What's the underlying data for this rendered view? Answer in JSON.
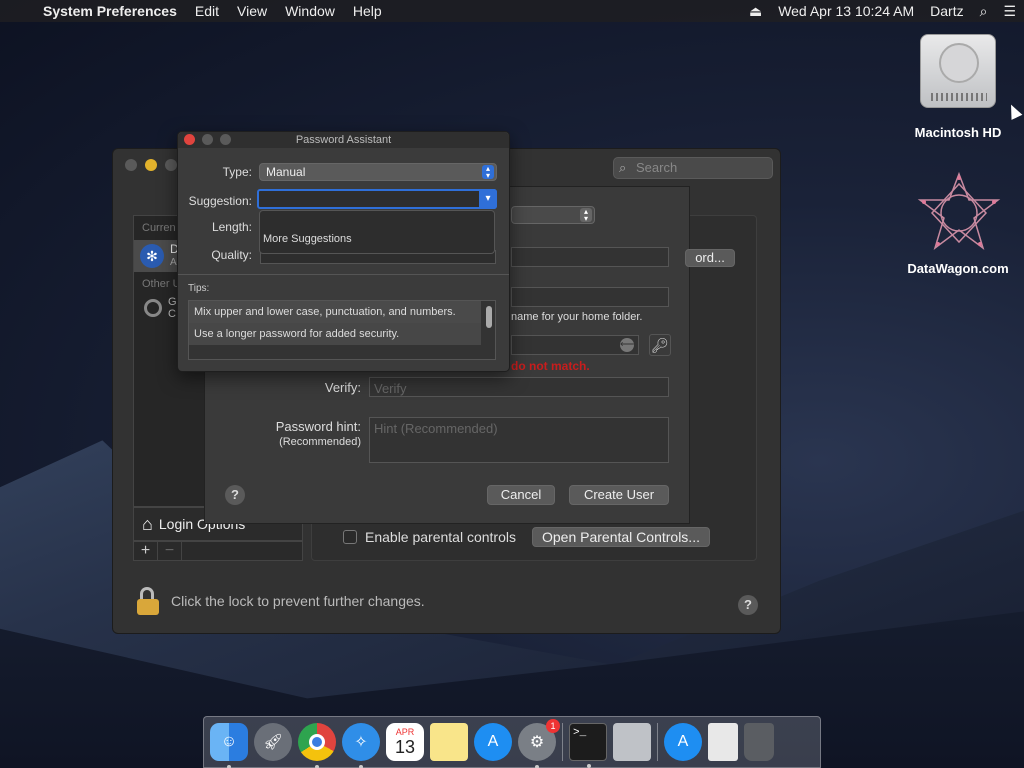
{
  "menubar": {
    "app_name": "System Preferences",
    "menus": [
      "Edit",
      "View",
      "Window",
      "Help"
    ],
    "clock": "Wed Apr 13  10:24 AM",
    "user": "Dartz"
  },
  "desktop": {
    "hd_label": "Macintosh HD",
    "datawagon_label": "DataWagon.com"
  },
  "prefs": {
    "search_placeholder": "Search",
    "user_list": {
      "current_header": "Curren",
      "other_header": "Other U",
      "selected_initial": "D",
      "selected_sub": "A",
      "other_initial": "G",
      "other_sub": "C"
    },
    "login_options": "Login Options",
    "plus": "+",
    "minus": "−",
    "enable_parental": "Enable parental controls",
    "open_parental": "Open Parental Controls...",
    "lock_text": "Click the lock to prevent further changes.",
    "help": "?"
  },
  "new_user_sheet": {
    "password_btn": "ord...",
    "home_folder_hint": "name for your home folder.",
    "mismatch_error": "do not match.",
    "verify_label": "Verify:",
    "verify_placeholder": "Verify",
    "hint_label": "Password hint:",
    "hint_sub": "(Recommended)",
    "hint_placeholder": "Hint (Recommended)",
    "cancel": "Cancel",
    "create": "Create User",
    "help": "?"
  },
  "password_assistant": {
    "title": "Password Assistant",
    "type_label": "Type:",
    "type_value": "Manual",
    "suggestion_label": "Suggestion:",
    "suggestion_value": "",
    "length_label": "Length:",
    "quality_label": "Quality:",
    "dropdown_item": "More Suggestions",
    "tips_label": "Tips:",
    "tips": [
      "Mix upper and lower case, punctuation, and numbers.",
      "Use a longer password for added security."
    ]
  },
  "dock": {
    "calendar_month": "APR",
    "calendar_day": "13",
    "prefs_badge": "1",
    "items": [
      "finder-icon",
      "launchpad-icon",
      "chrome-icon",
      "safari-icon",
      "calendar-icon",
      "notes-icon",
      "app-store-icon",
      "system-preferences-icon",
      "terminal-icon",
      "archive-utility-icon",
      "app-store-downloads-icon",
      "document-icon",
      "trash-icon"
    ]
  }
}
